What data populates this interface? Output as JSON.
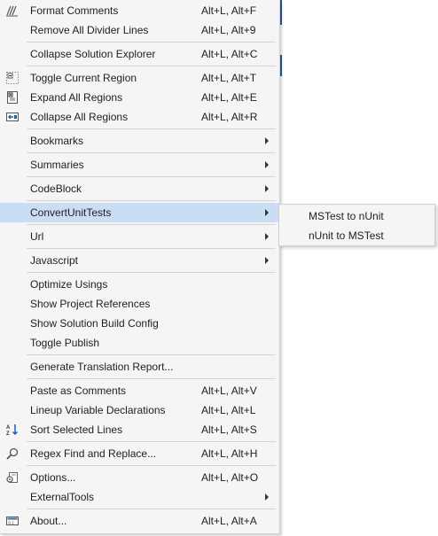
{
  "colors": {
    "menu_bg": "#f5f5f5",
    "highlight": "#c9def5",
    "separator": "#d5d5d5",
    "border": "#cccedb",
    "accent_strip": "#2b5797"
  },
  "menu": {
    "items": [
      {
        "label": "Format Comments",
        "shortcut": "Alt+L, Alt+F",
        "icon": "format-comments-icon"
      },
      {
        "label": "Remove All Divider Lines",
        "shortcut": "Alt+L, Alt+9"
      },
      {
        "label": "Collapse Solution Explorer",
        "shortcut": "Alt+L, Alt+C"
      },
      {
        "label": "Toggle Current Region",
        "shortcut": "Alt+L, Alt+T",
        "icon": "toggle-region-icon"
      },
      {
        "label": "Expand All Regions",
        "shortcut": "Alt+L, Alt+E",
        "icon": "expand-regions-icon"
      },
      {
        "label": "Collapse All Regions",
        "shortcut": "Alt+L, Alt+R",
        "icon": "collapse-regions-icon"
      },
      {
        "label": "Bookmarks",
        "has_submenu": true
      },
      {
        "label": "Summaries",
        "has_submenu": true
      },
      {
        "label": "CodeBlock",
        "has_submenu": true
      },
      {
        "label": "ConvertUnitTests",
        "has_submenu": true,
        "highlighted": true
      },
      {
        "label": "Url",
        "has_submenu": true
      },
      {
        "label": "Javascript",
        "has_submenu": true
      },
      {
        "label": "Optimize Usings"
      },
      {
        "label": "Show Project References"
      },
      {
        "label": "Show Solution Build Config"
      },
      {
        "label": "Toggle Publish"
      },
      {
        "label": "Generate Translation Report..."
      },
      {
        "label": "Paste as Comments",
        "shortcut": "Alt+L, Alt+V"
      },
      {
        "label": "Lineup Variable Declarations",
        "shortcut": "Alt+L, Alt+L"
      },
      {
        "label": "Sort Selected Lines",
        "shortcut": "Alt+L, Alt+S",
        "icon": "sort-az-icon"
      },
      {
        "label": "Regex Find and Replace...",
        "shortcut": "Alt+L, Alt+H",
        "icon": "search-icon"
      },
      {
        "label": "Options...",
        "shortcut": "Alt+L, Alt+O",
        "icon": "options-icon"
      },
      {
        "label": "ExternalTools",
        "has_submenu": true
      },
      {
        "label": "About...",
        "shortcut": "Alt+L, Alt+A",
        "icon": "about-icon"
      }
    ]
  },
  "submenu": {
    "items": [
      {
        "label": "MSTest to nUnit"
      },
      {
        "label": "nUnit to MSTest"
      }
    ]
  }
}
